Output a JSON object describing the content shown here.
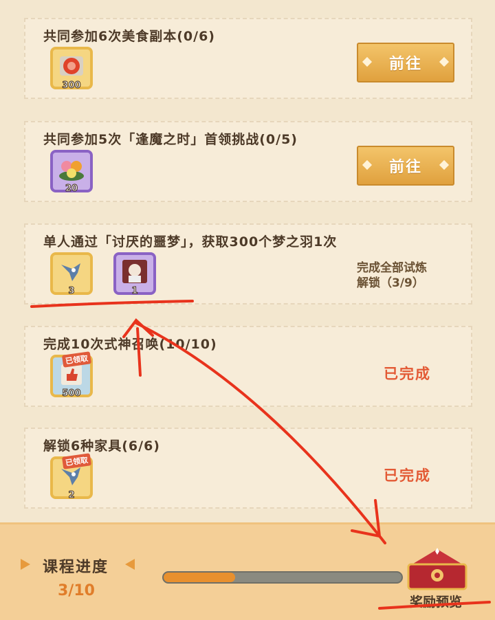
{
  "tasks": [
    {
      "title": "共同参加6次美食副本(0/6)",
      "rewards": [
        {
          "icon": "ticket-icon",
          "qty": "300"
        }
      ],
      "action": "前往"
    },
    {
      "title": "共同参加5次「逢魔之时」首领挑战(0/5)",
      "rewards": [
        {
          "icon": "food-platter-icon",
          "qty": "20"
        }
      ],
      "action": "前往"
    },
    {
      "title": "单人通过「讨厌的噩梦」，获取300个梦之羽1次",
      "rewards": [
        {
          "icon": "bird-icon",
          "qty": "3"
        },
        {
          "icon": "portrait-card-icon",
          "qty": "1"
        }
      ],
      "lock_line1": "完成全部试炼",
      "lock_line2": "解锁（3/9）"
    },
    {
      "title": "完成10次式神召唤(10/10)",
      "rewards": [
        {
          "icon": "thumbs-up-card-icon",
          "qty": "500",
          "tag": "已领取"
        }
      ],
      "status": "已完成"
    },
    {
      "title": "解锁6种家具(6/6)",
      "rewards": [
        {
          "icon": "bird-icon",
          "qty": "2",
          "tag": "已领取"
        }
      ],
      "status": "已完成"
    }
  ],
  "footer": {
    "progress_label": "课程进度",
    "progress_count": "3/10",
    "progress_fraction": 0.3,
    "reward_label": "奖励预览"
  },
  "colors": {
    "accent": "#e79a3c",
    "done": "#e35a35",
    "annotation": "#e8331c"
  }
}
